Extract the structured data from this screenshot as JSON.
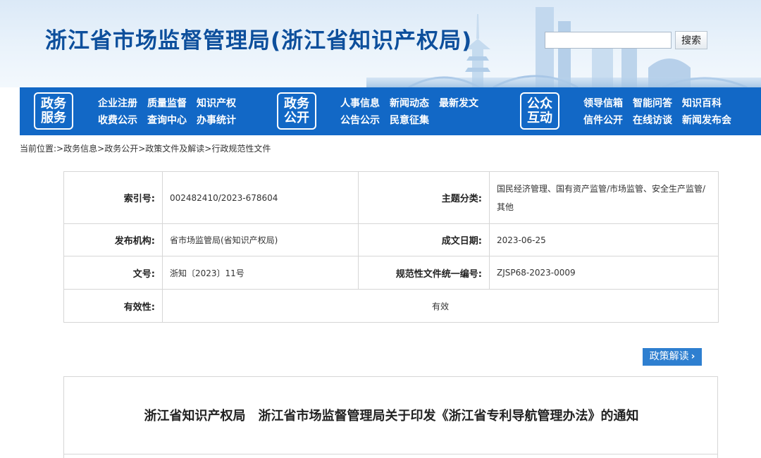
{
  "header": {
    "site_title": "浙江省市场监督管理局(浙江省知识产权局)",
    "search_placeholder": "",
    "search_button": "搜索"
  },
  "nav": [
    {
      "badge": [
        "政务",
        "服务"
      ],
      "rows": [
        [
          "企业注册",
          "质量监督",
          "知识产权"
        ],
        [
          "收费公示",
          "查询中心",
          "办事统计"
        ]
      ]
    },
    {
      "badge": [
        "政务",
        "公开"
      ],
      "rows": [
        [
          "人事信息",
          "新闻动态",
          "最新发文"
        ],
        [
          "公告公示",
          "民意征集"
        ]
      ]
    },
    {
      "badge": [
        "公众",
        "互动"
      ],
      "rows": [
        [
          "领导信箱",
          "智能问答",
          "知识百科"
        ],
        [
          "信件公开",
          "在线访谈",
          "新闻发布会"
        ]
      ]
    }
  ],
  "breadcrumb": {
    "prefix": "当前位置:",
    "items": [
      "政务信息",
      "政务公开",
      "政策文件及解读",
      "行政规范性文件"
    ],
    "separator": ">"
  },
  "info": {
    "index_label": "索引号:",
    "index_value": "002482410/2023-678604",
    "topic_label": "主题分类:",
    "topic_value": "国民经济管理、国有资产监管/市场监管、安全生产监管/其他",
    "publisher_label": "发布机构:",
    "publisher_value": "省市场监管局(省知识产权局)",
    "date_label": "成文日期:",
    "date_value": "2023-06-25",
    "doc_no_label": "文号:",
    "doc_no_value": "浙知〔2023〕11号",
    "unified_no_label": "规范性文件统一编号:",
    "unified_no_value": "ZJSP68-2023-0009",
    "validity_label": "有效性:",
    "validity_value": "有效"
  },
  "interpretation_button": "政策解读",
  "document": {
    "title": "浙江省知识产权局　浙江省市场监督管理局关于印发《浙江省专利导航管理办法》的通知"
  },
  "colors": {
    "title_blue": "#0d4f9c",
    "nav_blue": "#1268c6",
    "button_blue": "#2e7fd0"
  }
}
